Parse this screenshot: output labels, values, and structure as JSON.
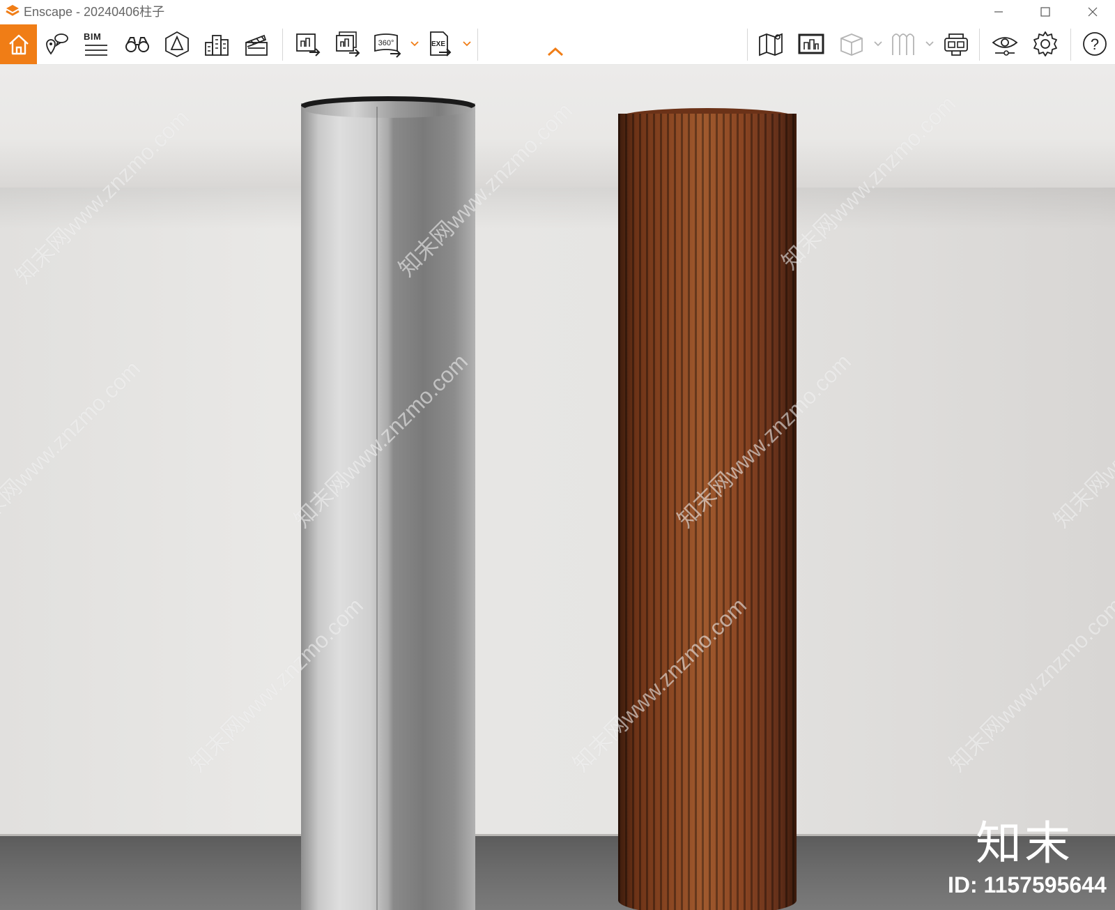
{
  "window": {
    "app_name": "Enscape",
    "title": "Enscape - 20240406柱子",
    "controls": [
      "minimize",
      "maximize",
      "close"
    ]
  },
  "toolbar": {
    "accent_color": "#f07d16",
    "left_buttons": [
      {
        "icon": "home-icon",
        "active": true
      },
      {
        "icon": "location-comment-icon"
      },
      {
        "icon": "bim-icon",
        "label": "BIM"
      },
      {
        "icon": "binoculars-icon"
      },
      {
        "icon": "view-cube-icon"
      },
      {
        "icon": "buildings-icon"
      },
      {
        "icon": "clapperboard-icon"
      },
      {
        "icon": "export-image-icon"
      },
      {
        "icon": "batch-export-icon"
      },
      {
        "icon": "panorama-360-icon",
        "label": "360°",
        "dropdown": true
      },
      {
        "icon": "export-exe-icon",
        "label": "EXE",
        "dropdown": true
      }
    ],
    "center_toggle": "collapse-toolbar-chevron",
    "right_buttons": [
      {
        "icon": "map-icon"
      },
      {
        "icon": "display-view-icon"
      },
      {
        "icon": "box-icon",
        "dropdown": true,
        "disabled": true
      },
      {
        "icon": "cloth-icon",
        "dropdown": true,
        "disabled": true
      },
      {
        "icon": "vr-headset-icon"
      },
      {
        "icon": "visual-settings-eye-icon"
      },
      {
        "icon": "settings-gear-icon"
      },
      {
        "icon": "help-icon",
        "label": "?"
      }
    ]
  },
  "viewport": {
    "scene": "two cylindrical columns: brushed metal column and vertical wood-slat column",
    "watermark_text": "知末网www.znzmo.com",
    "brand_text": "知末",
    "id_text": "ID: 1157595644"
  }
}
